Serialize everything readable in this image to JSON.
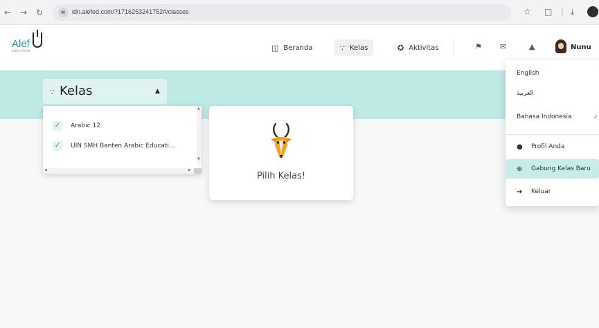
{
  "browser": {
    "url": "idn.alefed.com/?1716253241752#/classes"
  },
  "logo": {
    "text": "Alef",
    "subtext": "EDUCATION"
  },
  "nav": {
    "items": [
      {
        "label": "Beranda",
        "icon": "home-icon"
      },
      {
        "label": "Kelas",
        "icon": "classes-icon",
        "active": true
      },
      {
        "label": "Aktivitas",
        "icon": "activity-icon"
      }
    ]
  },
  "user": {
    "name": "Nunu"
  },
  "class_selector": {
    "label": "Kelas"
  },
  "class_list": [
    "Arabic 12",
    "UIN SMH Banten Arabic Educati..."
  ],
  "card": {
    "label": "Pilih Kelas!"
  },
  "user_menu": {
    "languages": [
      "English",
      "العربية",
      "Bahasa Indonesia"
    ],
    "profile": "Profil Anda",
    "join_class": "Gabung Kelas Baru",
    "logout": "Keluar"
  },
  "colors": {
    "banner": "#bfe9e5",
    "accent": "#2a8ea0",
    "highlight": "#c7ecea"
  }
}
